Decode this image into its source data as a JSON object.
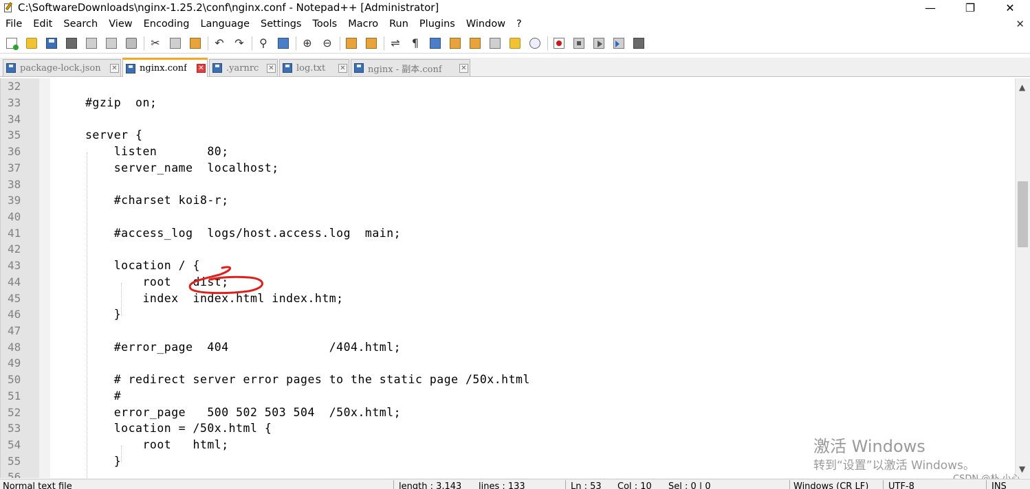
{
  "window": {
    "title": "C:\\SoftwareDownloads\\nginx-1.25.2\\conf\\nginx.conf - Notepad++ [Administrator]",
    "minimize": "—",
    "restore": "❐",
    "close": "✕"
  },
  "menu": {
    "items": [
      "File",
      "Edit",
      "Search",
      "View",
      "Encoding",
      "Language",
      "Settings",
      "Tools",
      "Macro",
      "Run",
      "Plugins",
      "Window",
      "?"
    ],
    "close_doc": "✕"
  },
  "tabs": [
    {
      "label": "package-lock.json",
      "active": false
    },
    {
      "label": "nginx.conf",
      "active": true
    },
    {
      "label": ".yarnrc",
      "active": false
    },
    {
      "label": "log.txt",
      "active": false
    },
    {
      "label": "nginx - 副本.conf",
      "active": false
    }
  ],
  "tab_close_glyph": "✕",
  "editor": {
    "lines": [
      {
        "num": "32",
        "text": ""
      },
      {
        "num": "33",
        "text": "#gzip  on;"
      },
      {
        "num": "34",
        "text": ""
      },
      {
        "num": "35",
        "text": "server {"
      },
      {
        "num": "36",
        "text": "    listen       80;"
      },
      {
        "num": "37",
        "text": "    server_name  localhost;"
      },
      {
        "num": "38",
        "text": ""
      },
      {
        "num": "39",
        "text": "    #charset koi8-r;"
      },
      {
        "num": "40",
        "text": ""
      },
      {
        "num": "41",
        "text": "    #access_log  logs/host.access.log  main;"
      },
      {
        "num": "42",
        "text": ""
      },
      {
        "num": "43",
        "text": "    location / {"
      },
      {
        "num": "44",
        "text": "        root   dist;"
      },
      {
        "num": "45",
        "text": "        index  index.html index.htm;"
      },
      {
        "num": "46",
        "text": "    }"
      },
      {
        "num": "47",
        "text": ""
      },
      {
        "num": "48",
        "text": "    #error_page  404              /404.html;"
      },
      {
        "num": "49",
        "text": ""
      },
      {
        "num": "50",
        "text": "    # redirect server error pages to the static page /50x.html"
      },
      {
        "num": "51",
        "text": "    #"
      },
      {
        "num": "52",
        "text": "    error_page   500 502 503 504  /50x.html;"
      },
      {
        "num": "53",
        "text": "    location = /50x.html {"
      },
      {
        "num": "54",
        "text": "        root   html;"
      },
      {
        "num": "55",
        "text": "    }"
      },
      {
        "num": "56",
        "text": ""
      }
    ]
  },
  "watermark": {
    "line1": "激活 Windows",
    "line2": "转到“设置”以激活 Windows。",
    "csdn": "CSDN @朴 小心"
  },
  "scrollbar": {
    "up": "▲",
    "down": "▼"
  },
  "status": {
    "file_type": "Normal text file",
    "length": "length : 3,143",
    "lines": "lines : 133",
    "ln": "Ln : 53",
    "col": "Col : 10",
    "sel": "Sel : 0 | 0",
    "eol": "Windows (CR LF)",
    "encoding": "UTF-8",
    "mode": "INS"
  },
  "colors": {
    "annotation_red": "#e0201c",
    "active_tab_accent": "#f5a623",
    "gutter": "#e4e4e4"
  }
}
